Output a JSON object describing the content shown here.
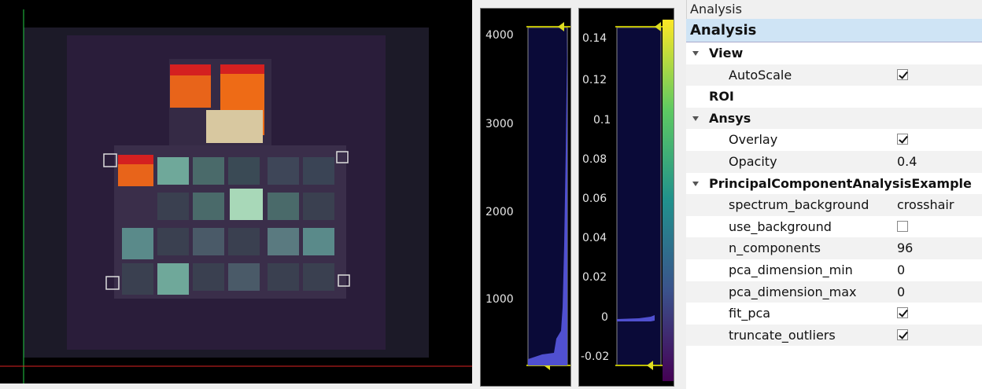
{
  "dock": {
    "title": "Analysis",
    "header": "Analysis"
  },
  "tree": [
    {
      "label": "View",
      "type": "group",
      "expanded": true,
      "depth": 1
    },
    {
      "label": "AutoScale",
      "type": "checkbox",
      "checked": true,
      "depth": 2
    },
    {
      "label": "ROI",
      "type": "group",
      "expanded": false,
      "depth": 1
    },
    {
      "label": "Ansys",
      "type": "group",
      "expanded": true,
      "depth": 1
    },
    {
      "label": "Overlay",
      "type": "checkbox",
      "checked": true,
      "depth": 2
    },
    {
      "label": "Opacity",
      "type": "value",
      "value": "0.4",
      "depth": 2
    },
    {
      "label": "PrincipalComponentAnalysisExample",
      "type": "group",
      "expanded": true,
      "depth": 1
    },
    {
      "label": "spectrum_background",
      "type": "value",
      "value": "crosshair",
      "depth": 2
    },
    {
      "label": "use_background",
      "type": "checkbox",
      "checked": false,
      "depth": 2
    },
    {
      "label": "n_components",
      "type": "value",
      "value": "96",
      "depth": 2
    },
    {
      "label": "pca_dimension_min",
      "type": "value",
      "value": "0",
      "depth": 2
    },
    {
      "label": "pca_dimension_max",
      "type": "value",
      "value": "0",
      "depth": 2
    },
    {
      "label": "fit_pca",
      "type": "checkbox",
      "checked": true,
      "depth": 2
    },
    {
      "label": "truncate_outliers",
      "type": "checkbox",
      "checked": true,
      "depth": 2
    }
  ],
  "histogram_left": {
    "ticks": [
      "4000",
      "3000",
      "2000",
      "1000"
    ]
  },
  "histogram_right": {
    "ticks": [
      "0.14",
      "0.12",
      "0.1",
      "0.08",
      "0.06",
      "0.04",
      "0.02",
      "0",
      "-0.02"
    ]
  },
  "colors": {
    "overlay_orange": "#e8641a",
    "overlay_red": "#d42020",
    "overlay_teal": "#6fa89a",
    "hist_fill": "#2020a0",
    "accent_line": "#22cc44",
    "crosshair_red": "#dd2222",
    "header_bg": "#cfe4f5"
  }
}
